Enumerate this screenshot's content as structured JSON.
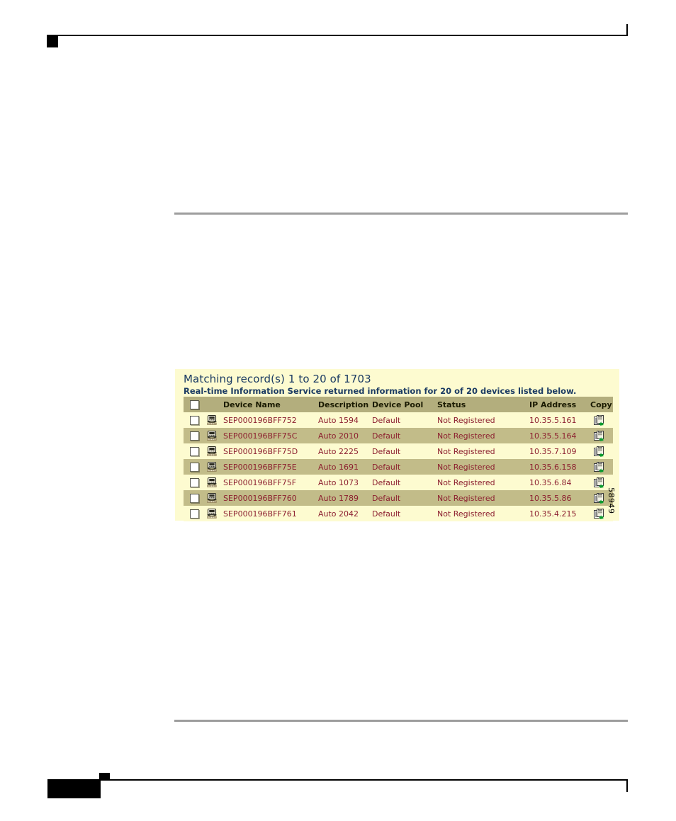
{
  "page": {
    "figure_id": "58949"
  },
  "figure": {
    "title": "Matching record(s) 1 to 20 of 1703",
    "subtitle": "Real-time Information Service returned information for 20 of 20 devices listed below.",
    "colors": {
      "panel_background": "#fdfbd0",
      "header_band": "#b3ae7d",
      "row_alt": "#c2bc89",
      "title_text": "#1b3b63",
      "data_text": "#8c1f2f",
      "rule": "#9d9d9d"
    },
    "table": {
      "columns": [
        {
          "key": "select",
          "label": ""
        },
        {
          "key": "icon",
          "label": ""
        },
        {
          "key": "device_name",
          "label": "Device Name"
        },
        {
          "key": "description",
          "label": "Description"
        },
        {
          "key": "device_pool",
          "label": "Device Pool"
        },
        {
          "key": "status",
          "label": "Status"
        },
        {
          "key": "ip_address",
          "label": "IP Address"
        },
        {
          "key": "copy",
          "label": "Copy"
        }
      ],
      "header_select_all": "select-all-checkbox",
      "rows": [
        {
          "device_name": "SEP000196BFF752",
          "description": "Auto 1594",
          "device_pool": "Default",
          "status": "Not Registered",
          "ip_address": "10.35.5.161",
          "icon": "phone-icon",
          "copy_icon": "copy-icon"
        },
        {
          "device_name": "SEP000196BFF75C",
          "description": "Auto 2010",
          "device_pool": "Default",
          "status": "Not Registered",
          "ip_address": "10.35.5.164",
          "icon": "phone-icon",
          "copy_icon": "copy-icon"
        },
        {
          "device_name": "SEP000196BFF75D",
          "description": "Auto 2225",
          "device_pool": "Default",
          "status": "Not Registered",
          "ip_address": "10.35.7.109",
          "icon": "phone-icon",
          "copy_icon": "copy-icon"
        },
        {
          "device_name": "SEP000196BFF75E",
          "description": "Auto 1691",
          "device_pool": "Default",
          "status": "Not Registered",
          "ip_address": "10.35.6.158",
          "icon": "phone-icon",
          "copy_icon": "copy-icon"
        },
        {
          "device_name": "SEP000196BFF75F",
          "description": "Auto 1073",
          "device_pool": "Default",
          "status": "Not Registered",
          "ip_address": "10.35.6.84",
          "icon": "phone-icon",
          "copy_icon": "copy-icon"
        },
        {
          "device_name": "SEP000196BFF760",
          "description": "Auto 1789",
          "device_pool": "Default",
          "status": "Not Registered",
          "ip_address": "10.35.5.86",
          "icon": "phone-icon",
          "copy_icon": "copy-icon"
        },
        {
          "device_name": "SEP000196BFF761",
          "description": "Auto 2042",
          "device_pool": "Default",
          "status": "Not Registered",
          "ip_address": "10.35.4.215",
          "icon": "phone-icon",
          "copy_icon": "copy-icon"
        }
      ]
    }
  }
}
